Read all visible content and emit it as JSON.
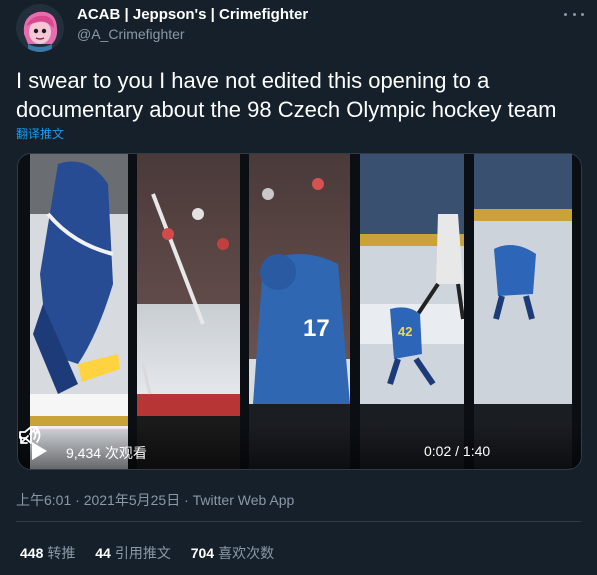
{
  "author": {
    "name": "ACAB | Jeppson's | Crimefighter",
    "handle": "@A_Crimefighter"
  },
  "tweet": {
    "text_line1": "I swear to you I have not edited this opening to a",
    "text_line2": "documentary about the 98 Czech Olympic hockey team",
    "translate_label": "翻译推文"
  },
  "video": {
    "views": "9,434 次观看",
    "time": "0:02 / 1:40",
    "panel_number": "17",
    "panel_number_2": "42"
  },
  "meta": {
    "timestamp": "上午6:01 · 2021年5月25日 · Twitter Web App"
  },
  "stats": {
    "retweets_count": "448",
    "retweets_label": "转推",
    "quotes_count": "44",
    "quotes_label": "引用推文",
    "likes_count": "704",
    "likes_label": "喜欢次数"
  },
  "colors": {
    "background": "#15202b",
    "link": "#1d9bf0",
    "secondary_text": "#8b98a5"
  },
  "icons": [
    "avatar",
    "more-icon",
    "play-icon",
    "volume-icon",
    "fullscreen-icon"
  ]
}
